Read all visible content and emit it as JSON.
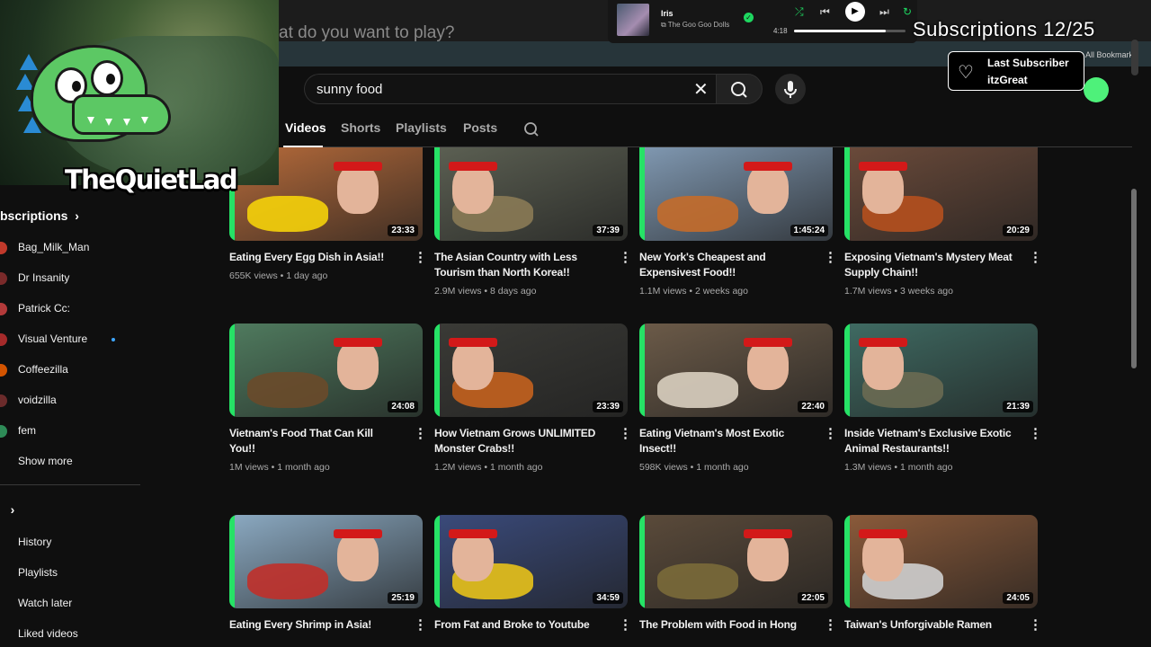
{
  "browser": {
    "prompt_text": "at do you want to play?",
    "bookmarks": "All Bookmarks"
  },
  "music": {
    "song": "Iris",
    "artist": "The Goo Goo Dolls",
    "time": "4:18",
    "progress": 0.82
  },
  "overlay": {
    "subscriptions": "Subscriptions 12/25",
    "last_sub_title": "Last Subscriber",
    "last_sub_name": "itzGreat",
    "streamer": "TheQuietLad"
  },
  "search": {
    "query": "sunny food"
  },
  "tabs": [
    "Videos",
    "Shorts",
    "Playlists",
    "Posts"
  ],
  "sidebar": {
    "subs_heading": "bscriptions",
    "channels": [
      {
        "name": "Bag_Milk_Man",
        "color": "#c0392b",
        "new": false
      },
      {
        "name": "Dr Insanity",
        "color": "#7a2a2a",
        "new": false
      },
      {
        "name": "Patrick Cc:",
        "color": "#b33a3a",
        "new": false
      },
      {
        "name": "Visual Venture",
        "color": "#a52a2a",
        "new": true
      },
      {
        "name": "Coffeezilla",
        "color": "#d35400",
        "new": false
      },
      {
        "name": "voidzilla",
        "color": "#6b2b2b",
        "new": false
      },
      {
        "name": "fem",
        "color": "#2e8b57",
        "new": false
      }
    ],
    "show_more": "Show more",
    "you_heading": "",
    "you_items": [
      "History",
      "Playlists",
      "Watch later",
      "Liked videos"
    ]
  },
  "videos": [
    {
      "title": "Eating Every Egg Dish in Asia!!",
      "views": "655K views",
      "age": "1 day ago",
      "duration": "23:33",
      "bg": "#b56a3a",
      "accent": "#f5d20a"
    },
    {
      "title": "The Asian Country with Less Tourism than North Korea!!",
      "views": "2.9M views",
      "age": "8 days ago",
      "duration": "37:39",
      "bg": "#5b5f52",
      "accent": "#8a7a55"
    },
    {
      "title": "New York's Cheapest and Expensivest Food!!",
      "views": "1.1M views",
      "age": "2 weeks ago",
      "duration": "1:45:24",
      "bg": "#7f97b0",
      "accent": "#c46b2a"
    },
    {
      "title": "Exposing Vietnam's Mystery Meat Supply Chain!!",
      "views": "1.7M views",
      "age": "3 weeks ago",
      "duration": "20:29",
      "bg": "#6a4a3a",
      "accent": "#b5501e"
    },
    {
      "title": "Vietnam's Food That Can Kill You!!",
      "views": "1M views",
      "age": "1 month ago",
      "duration": "24:08",
      "bg": "#4f7a5e",
      "accent": "#6a4a2a"
    },
    {
      "title": "How Vietnam Grows UNLIMITED Monster Crabs!!",
      "views": "1.2M views",
      "age": "1 month ago",
      "duration": "23:39",
      "bg": "#3a3a36",
      "accent": "#c4621e"
    },
    {
      "title": "Eating Vietnam's Most Exotic Insect!!",
      "views": "598K views",
      "age": "1 month ago",
      "duration": "22:40",
      "bg": "#6b5a48",
      "accent": "#d9cfc0"
    },
    {
      "title": "Inside Vietnam's Exclusive Exotic Animal Restaurants!!",
      "views": "1.3M views",
      "age": "1 month ago",
      "duration": "21:39",
      "bg": "#3f6a62",
      "accent": "#6a6a52"
    },
    {
      "title": "Eating Every Shrimp in Asia!",
      "views": "",
      "age": "",
      "duration": "25:19",
      "bg": "#8aa8c0",
      "accent": "#c0302a"
    },
    {
      "title": "From Fat and Broke to Youtube",
      "views": "",
      "age": "",
      "duration": "34:59",
      "bg": "#3a4a7a",
      "accent": "#e8c21a"
    },
    {
      "title": "The Problem with Food in Hong",
      "views": "",
      "age": "",
      "duration": "22:05",
      "bg": "#5a4a3a",
      "accent": "#7a6a3a"
    },
    {
      "title": "Taiwan's Unforgivable Ramen",
      "views": "",
      "age": "",
      "duration": "24:05",
      "bg": "#8a5a3a",
      "accent": "#cfcfcf"
    }
  ]
}
